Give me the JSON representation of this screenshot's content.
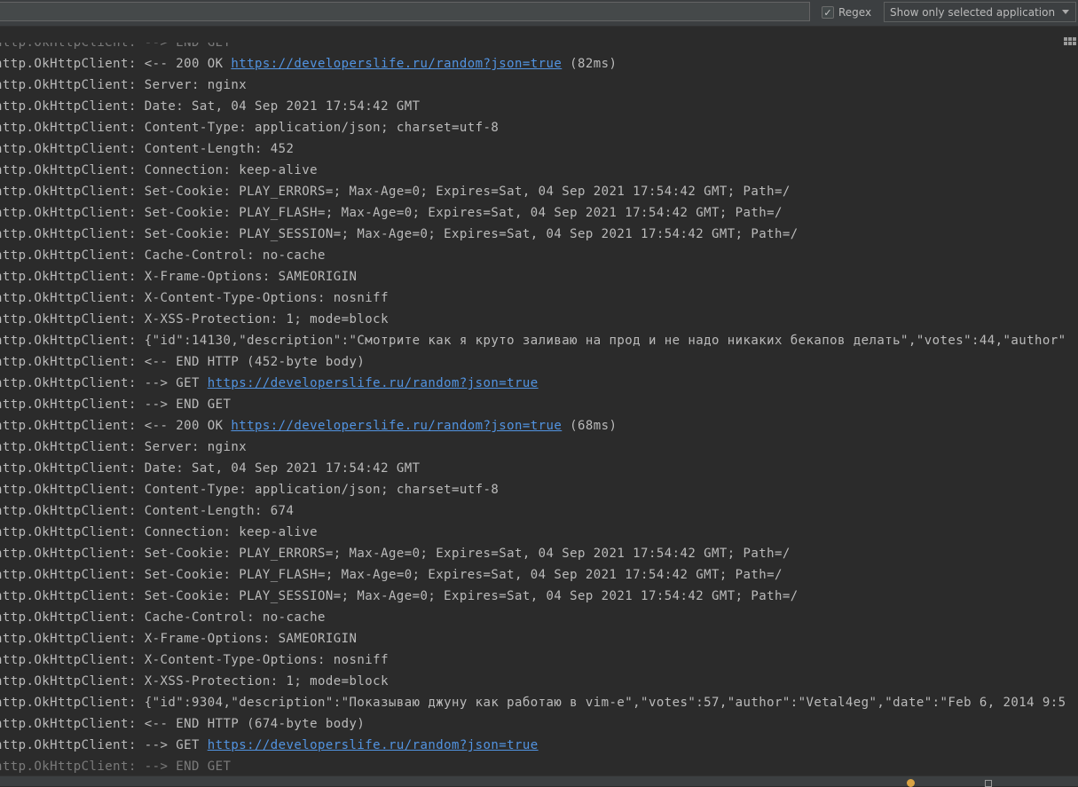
{
  "toolbar": {
    "filter_value": "",
    "regex_label": "Regex",
    "regex_checked": "✓",
    "app_filter": "Show only selected application"
  },
  "log": {
    "tag": "http.OkHttpClient: ",
    "link_url": "https://developerslife.ru/random?json=true",
    "lines": [
      {
        "pre": "--> END GET",
        "link": "",
        "post": ""
      },
      {
        "pre": "<-- 200 OK ",
        "link": "https://developerslife.ru/random?json=true",
        "post": " (82ms)"
      },
      {
        "pre": "Server: nginx",
        "link": "",
        "post": ""
      },
      {
        "pre": "Date: Sat, 04 Sep 2021 17:54:42 GMT",
        "link": "",
        "post": ""
      },
      {
        "pre": "Content-Type: application/json; charset=utf-8",
        "link": "",
        "post": ""
      },
      {
        "pre": "Content-Length: 452",
        "link": "",
        "post": ""
      },
      {
        "pre": "Connection: keep-alive",
        "link": "",
        "post": ""
      },
      {
        "pre": "Set-Cookie: PLAY_ERRORS=; Max-Age=0; Expires=Sat, 04 Sep 2021 17:54:42 GMT; Path=/",
        "link": "",
        "post": ""
      },
      {
        "pre": "Set-Cookie: PLAY_FLASH=; Max-Age=0; Expires=Sat, 04 Sep 2021 17:54:42 GMT; Path=/",
        "link": "",
        "post": ""
      },
      {
        "pre": "Set-Cookie: PLAY_SESSION=; Max-Age=0; Expires=Sat, 04 Sep 2021 17:54:42 GMT; Path=/",
        "link": "",
        "post": ""
      },
      {
        "pre": "Cache-Control: no-cache",
        "link": "",
        "post": ""
      },
      {
        "pre": "X-Frame-Options: SAMEORIGIN",
        "link": "",
        "post": ""
      },
      {
        "pre": "X-Content-Type-Options: nosniff",
        "link": "",
        "post": ""
      },
      {
        "pre": "X-XSS-Protection: 1; mode=block",
        "link": "",
        "post": ""
      },
      {
        "pre": "{\"id\":14130,\"description\":\"Смотрите как я круто заливаю на прод и не надо никаких бекапов делать\",\"votes\":44,\"author\"",
        "link": "",
        "post": ""
      },
      {
        "pre": "<-- END HTTP (452-byte body)",
        "link": "",
        "post": ""
      },
      {
        "pre": "--> GET ",
        "link": "https://developerslife.ru/random?json=true",
        "post": ""
      },
      {
        "pre": "--> END GET",
        "link": "",
        "post": ""
      },
      {
        "pre": "<-- 200 OK ",
        "link": "https://developerslife.ru/random?json=true",
        "post": " (68ms)"
      },
      {
        "pre": "Server: nginx",
        "link": "",
        "post": ""
      },
      {
        "pre": "Date: Sat, 04 Sep 2021 17:54:42 GMT",
        "link": "",
        "post": ""
      },
      {
        "pre": "Content-Type: application/json; charset=utf-8",
        "link": "",
        "post": ""
      },
      {
        "pre": "Content-Length: 674",
        "link": "",
        "post": ""
      },
      {
        "pre": "Connection: keep-alive",
        "link": "",
        "post": ""
      },
      {
        "pre": "Set-Cookie: PLAY_ERRORS=; Max-Age=0; Expires=Sat, 04 Sep 2021 17:54:42 GMT; Path=/",
        "link": "",
        "post": ""
      },
      {
        "pre": "Set-Cookie: PLAY_FLASH=; Max-Age=0; Expires=Sat, 04 Sep 2021 17:54:42 GMT; Path=/",
        "link": "",
        "post": ""
      },
      {
        "pre": "Set-Cookie: PLAY_SESSION=; Max-Age=0; Expires=Sat, 04 Sep 2021 17:54:42 GMT; Path=/",
        "link": "",
        "post": ""
      },
      {
        "pre": "Cache-Control: no-cache",
        "link": "",
        "post": ""
      },
      {
        "pre": "X-Frame-Options: SAMEORIGIN",
        "link": "",
        "post": ""
      },
      {
        "pre": "X-Content-Type-Options: nosniff",
        "link": "",
        "post": ""
      },
      {
        "pre": "X-XSS-Protection: 1; mode=block",
        "link": "",
        "post": ""
      },
      {
        "pre": "{\"id\":9304,\"description\":\"Показываю джуну как работаю в vim-е\",\"votes\":57,\"author\":\"Vetal4eg\",\"date\":\"Feb 6, 2014 9:5",
        "link": "",
        "post": ""
      },
      {
        "pre": "<-- END HTTP (674-byte body)",
        "link": "",
        "post": ""
      },
      {
        "pre": "--> GET ",
        "link": "https://developerslife.ru/random?json=true",
        "post": ""
      },
      {
        "pre": "--> END GET",
        "link": "",
        "post": ""
      }
    ]
  },
  "icons": {
    "menu": "menu-grid-icon",
    "status_warning": "warning-dot-icon",
    "status_layout": "layout-box-icon"
  },
  "colors": {
    "background": "#2b2b2b",
    "text": "#bbbbbb",
    "link": "#5294e2",
    "toolbar": "#3c3f41"
  }
}
